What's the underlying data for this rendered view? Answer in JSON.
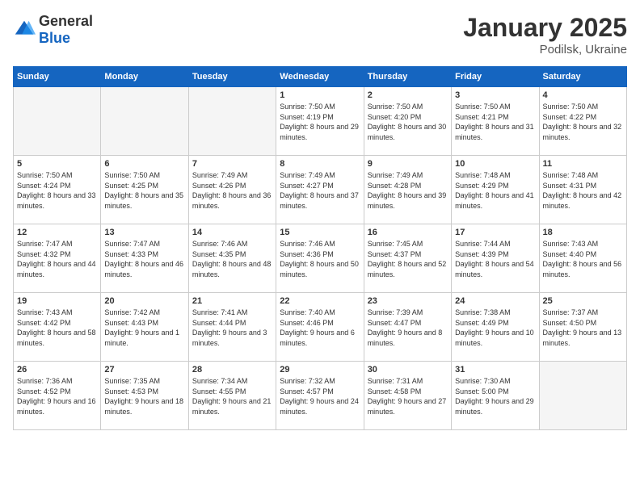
{
  "header": {
    "logo_general": "General",
    "logo_blue": "Blue",
    "month": "January 2025",
    "location": "Podilsk, Ukraine"
  },
  "weekdays": [
    "Sunday",
    "Monday",
    "Tuesday",
    "Wednesday",
    "Thursday",
    "Friday",
    "Saturday"
  ],
  "weeks": [
    [
      {
        "day": "",
        "info": ""
      },
      {
        "day": "",
        "info": ""
      },
      {
        "day": "",
        "info": ""
      },
      {
        "day": "1",
        "info": "Sunrise: 7:50 AM\nSunset: 4:19 PM\nDaylight: 8 hours and 29 minutes."
      },
      {
        "day": "2",
        "info": "Sunrise: 7:50 AM\nSunset: 4:20 PM\nDaylight: 8 hours and 30 minutes."
      },
      {
        "day": "3",
        "info": "Sunrise: 7:50 AM\nSunset: 4:21 PM\nDaylight: 8 hours and 31 minutes."
      },
      {
        "day": "4",
        "info": "Sunrise: 7:50 AM\nSunset: 4:22 PM\nDaylight: 8 hours and 32 minutes."
      }
    ],
    [
      {
        "day": "5",
        "info": "Sunrise: 7:50 AM\nSunset: 4:24 PM\nDaylight: 8 hours and 33 minutes."
      },
      {
        "day": "6",
        "info": "Sunrise: 7:50 AM\nSunset: 4:25 PM\nDaylight: 8 hours and 35 minutes."
      },
      {
        "day": "7",
        "info": "Sunrise: 7:49 AM\nSunset: 4:26 PM\nDaylight: 8 hours and 36 minutes."
      },
      {
        "day": "8",
        "info": "Sunrise: 7:49 AM\nSunset: 4:27 PM\nDaylight: 8 hours and 37 minutes."
      },
      {
        "day": "9",
        "info": "Sunrise: 7:49 AM\nSunset: 4:28 PM\nDaylight: 8 hours and 39 minutes."
      },
      {
        "day": "10",
        "info": "Sunrise: 7:48 AM\nSunset: 4:29 PM\nDaylight: 8 hours and 41 minutes."
      },
      {
        "day": "11",
        "info": "Sunrise: 7:48 AM\nSunset: 4:31 PM\nDaylight: 8 hours and 42 minutes."
      }
    ],
    [
      {
        "day": "12",
        "info": "Sunrise: 7:47 AM\nSunset: 4:32 PM\nDaylight: 8 hours and 44 minutes."
      },
      {
        "day": "13",
        "info": "Sunrise: 7:47 AM\nSunset: 4:33 PM\nDaylight: 8 hours and 46 minutes."
      },
      {
        "day": "14",
        "info": "Sunrise: 7:46 AM\nSunset: 4:35 PM\nDaylight: 8 hours and 48 minutes."
      },
      {
        "day": "15",
        "info": "Sunrise: 7:46 AM\nSunset: 4:36 PM\nDaylight: 8 hours and 50 minutes."
      },
      {
        "day": "16",
        "info": "Sunrise: 7:45 AM\nSunset: 4:37 PM\nDaylight: 8 hours and 52 minutes."
      },
      {
        "day": "17",
        "info": "Sunrise: 7:44 AM\nSunset: 4:39 PM\nDaylight: 8 hours and 54 minutes."
      },
      {
        "day": "18",
        "info": "Sunrise: 7:43 AM\nSunset: 4:40 PM\nDaylight: 8 hours and 56 minutes."
      }
    ],
    [
      {
        "day": "19",
        "info": "Sunrise: 7:43 AM\nSunset: 4:42 PM\nDaylight: 8 hours and 58 minutes."
      },
      {
        "day": "20",
        "info": "Sunrise: 7:42 AM\nSunset: 4:43 PM\nDaylight: 9 hours and 1 minute."
      },
      {
        "day": "21",
        "info": "Sunrise: 7:41 AM\nSunset: 4:44 PM\nDaylight: 9 hours and 3 minutes."
      },
      {
        "day": "22",
        "info": "Sunrise: 7:40 AM\nSunset: 4:46 PM\nDaylight: 9 hours and 6 minutes."
      },
      {
        "day": "23",
        "info": "Sunrise: 7:39 AM\nSunset: 4:47 PM\nDaylight: 9 hours and 8 minutes."
      },
      {
        "day": "24",
        "info": "Sunrise: 7:38 AM\nSunset: 4:49 PM\nDaylight: 9 hours and 10 minutes."
      },
      {
        "day": "25",
        "info": "Sunrise: 7:37 AM\nSunset: 4:50 PM\nDaylight: 9 hours and 13 minutes."
      }
    ],
    [
      {
        "day": "26",
        "info": "Sunrise: 7:36 AM\nSunset: 4:52 PM\nDaylight: 9 hours and 16 minutes."
      },
      {
        "day": "27",
        "info": "Sunrise: 7:35 AM\nSunset: 4:53 PM\nDaylight: 9 hours and 18 minutes."
      },
      {
        "day": "28",
        "info": "Sunrise: 7:34 AM\nSunset: 4:55 PM\nDaylight: 9 hours and 21 minutes."
      },
      {
        "day": "29",
        "info": "Sunrise: 7:32 AM\nSunset: 4:57 PM\nDaylight: 9 hours and 24 minutes."
      },
      {
        "day": "30",
        "info": "Sunrise: 7:31 AM\nSunset: 4:58 PM\nDaylight: 9 hours and 27 minutes."
      },
      {
        "day": "31",
        "info": "Sunrise: 7:30 AM\nSunset: 5:00 PM\nDaylight: 9 hours and 29 minutes."
      },
      {
        "day": "",
        "info": ""
      }
    ]
  ]
}
